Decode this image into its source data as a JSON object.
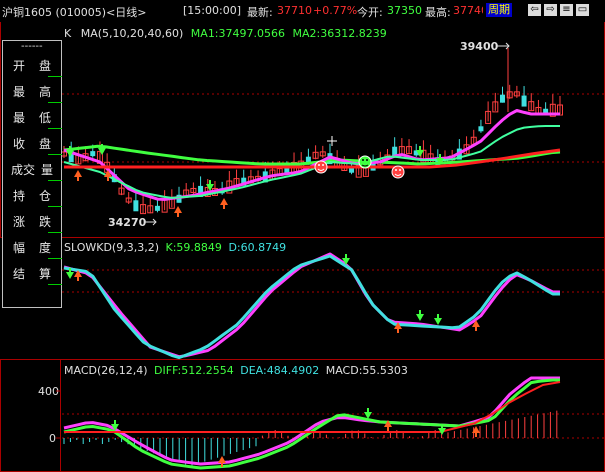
{
  "title_bar": {
    "instrument": "沪铜1605 (010005)<日线>",
    "time": "[15:00:00]",
    "latest_label": "最新:",
    "latest_value": "37710",
    "change": "+0.77%",
    "open_label": "今开:",
    "open_value": "37350",
    "high_label": "最高:",
    "high_value": "37740",
    "period_label": "周期",
    "nav_buttons": [
      "⇦",
      "⇨",
      "≡",
      "▭"
    ]
  },
  "side_menu": {
    "divider": "------",
    "items": [
      {
        "left": "开",
        "right": "盘"
      },
      {
        "left": "最",
        "right": "高"
      },
      {
        "left": "最",
        "right": "低"
      },
      {
        "left": "收",
        "right": "盘"
      },
      {
        "left": "成交",
        "right": "量"
      },
      {
        "left": "持",
        "right": "仓"
      },
      {
        "left": "涨",
        "right": "跌"
      },
      {
        "left": "幅",
        "right": "度"
      },
      {
        "left": "结",
        "right": "算"
      }
    ]
  },
  "price_panel": {
    "label": "K",
    "ma_params": "MA(5,10,20,40,60)",
    "ma1": "MA1:37497.0566",
    "ma2": "MA2:36312.8239",
    "high_marker": "39400",
    "low_marker": "34270"
  },
  "kd_panel": {
    "name": "SLOWKD(9,3,3,2)",
    "k": "K:59.8849",
    "d": "D:60.8749"
  },
  "macd_panel": {
    "name": "MACD(26,12,4)",
    "diff": "DIFF:512.2554",
    "dea": "DEA:484.4902",
    "macd": "MACD:55.5303",
    "y_ticks": [
      "400",
      "0"
    ]
  },
  "colors": {
    "up": "#ff4040",
    "down": "#40e0e0",
    "ma1": "#ff40ff",
    "ma2": "#40ff40",
    "ma3": "#ff2020",
    "grid": "#aa0000",
    "latest": "#ff3030",
    "label_yellow": "#ffff00"
  }
}
